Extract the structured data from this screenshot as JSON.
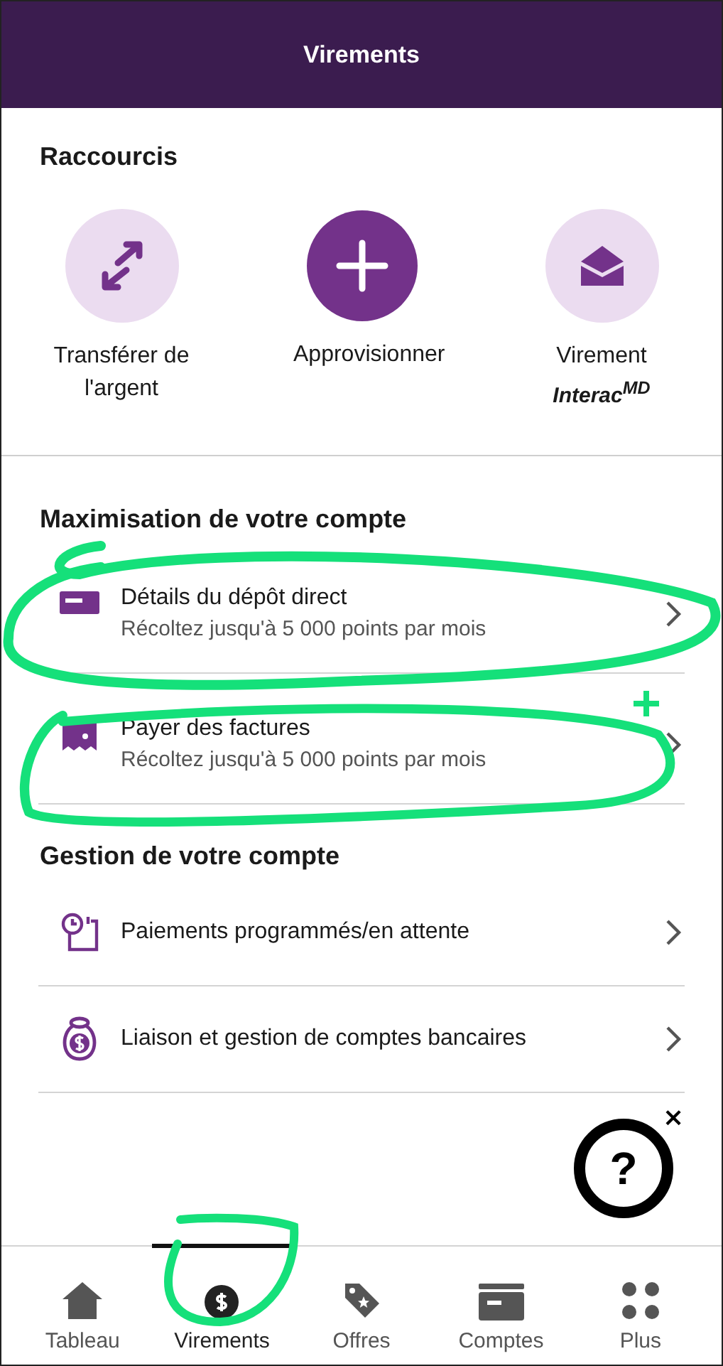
{
  "header": {
    "title": "Virements"
  },
  "shortcuts": {
    "title": "Raccourcis",
    "items": [
      {
        "kind": "transfer",
        "primary": false,
        "label": "Transférer de l'argent"
      },
      {
        "kind": "add",
        "primary": true,
        "label": "Approvisionner"
      },
      {
        "kind": "envelope",
        "primary": false,
        "label": "Virement",
        "sublabel": "Interac$^{MD}$"
      }
    ]
  },
  "sections": [
    {
      "title": "Maximisation de votre compte",
      "rows": [
        {
          "kind": "card",
          "title": "Détails du dépôt direct",
          "subtitle": "Récoltez jusqu'à 5 000 points par mois"
        },
        {
          "kind": "bill",
          "title": "Payer des factures",
          "subtitle": "Récoltez jusqu'à 5 000 points par mois"
        }
      ]
    },
    {
      "title": "Gestion de votre compte",
      "rows": [
        {
          "kind": "schedule",
          "title": "Paiements programmés/en attente"
        },
        {
          "kind": "moneybag",
          "title": "Liaison et gestion de comptes bancaires"
        }
      ]
    }
  ],
  "help": {
    "symbol": "?",
    "close": "×"
  },
  "nav": [
    {
      "kind": "home",
      "label": "Tableau",
      "selected": false
    },
    {
      "kind": "dollar",
      "label": "Virements",
      "selected": true
    },
    {
      "kind": "tag",
      "label": "Offres",
      "selected": false
    },
    {
      "kind": "card",
      "label": "Comptes",
      "selected": false
    },
    {
      "kind": "dots",
      "label": "Plus",
      "selected": false
    }
  ]
}
